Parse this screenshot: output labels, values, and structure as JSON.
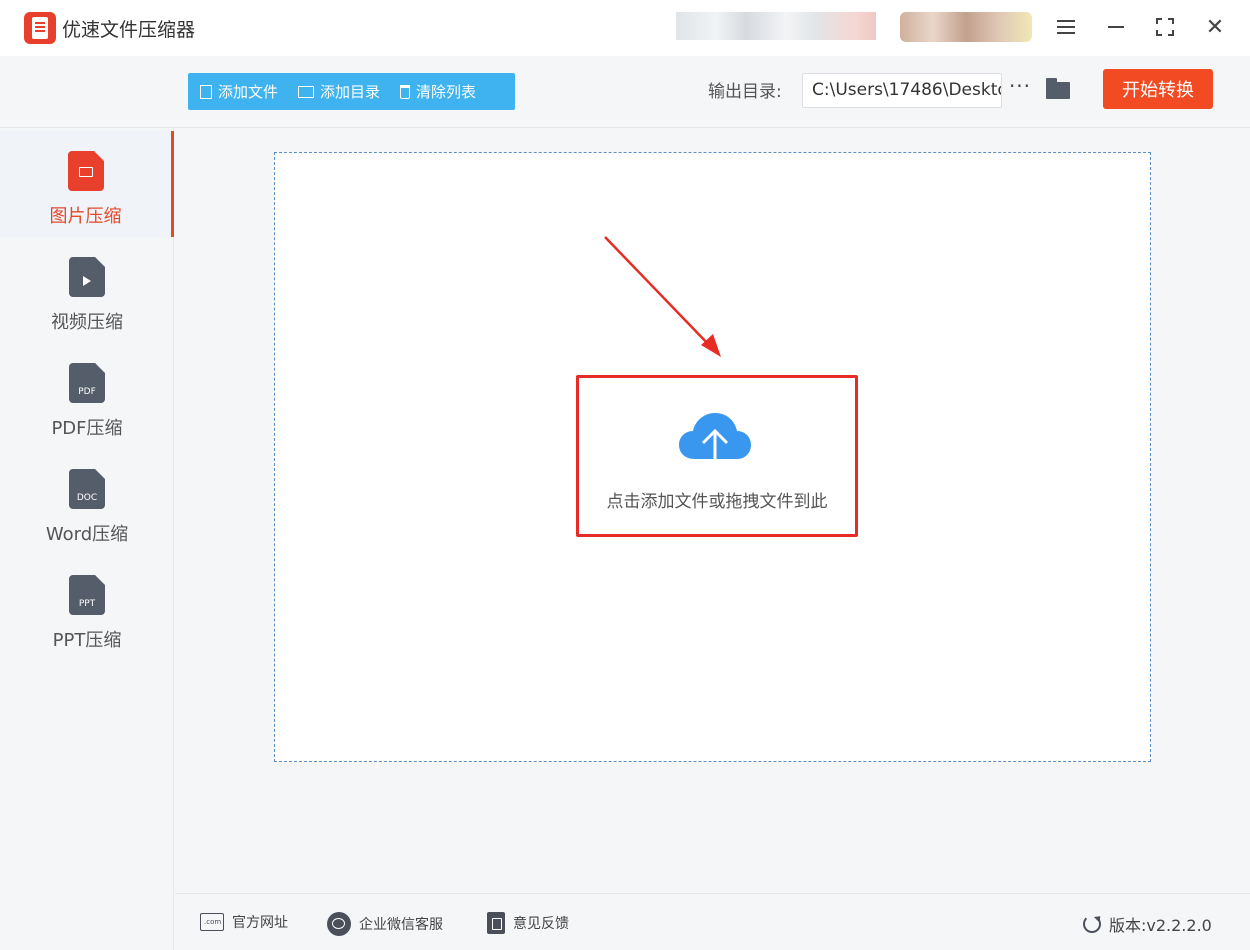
{
  "app": {
    "title": "优速文件压缩器"
  },
  "titlebar": {
    "icons": [
      "menu-icon",
      "minimize-icon",
      "maximize-icon",
      "close-icon"
    ],
    "close_glyph": "✕"
  },
  "toolbar": {
    "add_file": "添加文件",
    "add_folder": "添加目录",
    "clear_list": "清除列表",
    "output_label": "输出目录:",
    "output_path": "C:\\Users\\17486\\Deskto",
    "more_glyph": "···",
    "start": "开始转换",
    "colors": {
      "button_group": "#3fb2f0",
      "start_button": "#f24a22"
    }
  },
  "sidebar": {
    "items": [
      {
        "label": "图片压缩",
        "icon_text": "",
        "color": "#e8402c",
        "active": true
      },
      {
        "label": "视频压缩",
        "icon_text": "",
        "color": "#555d6b",
        "active": false
      },
      {
        "label": "PDF压缩",
        "icon_text": "PDF",
        "color": "#555d6b",
        "active": false
      },
      {
        "label": "Word压缩",
        "icon_text": "DOC",
        "color": "#555d6b",
        "active": false
      },
      {
        "label": "PPT压缩",
        "icon_text": "PPT",
        "color": "#555d6b",
        "active": false
      }
    ],
    "accent": "#e24a2c"
  },
  "main": {
    "drop_text": "点击添加文件或拖拽文件到此",
    "highlight_color": "#e62c24",
    "cloud_color": "#3a97f0"
  },
  "footer": {
    "website": "官方网址",
    "wechat": "企业微信客服",
    "feedback": "意见反馈",
    "version": "版本:v2.2.2.0"
  }
}
